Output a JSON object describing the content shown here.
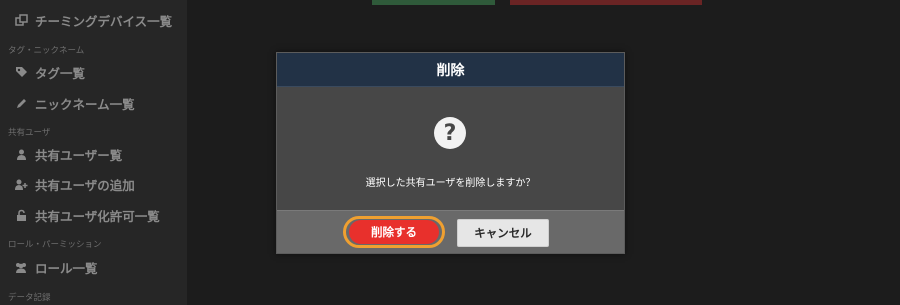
{
  "sidebar": {
    "items": [
      {
        "label": "チーミングデバイス一覧",
        "icon": "device-icon"
      },
      {
        "section": "タグ・ニックネーム"
      },
      {
        "label": "タグ一覧",
        "icon": "tag-icon"
      },
      {
        "label": "ニックネーム一覧",
        "icon": "pencil-icon"
      },
      {
        "section": "共有ユーザ"
      },
      {
        "label": "共有ユーザー覧",
        "icon": "user-icon"
      },
      {
        "label": "共有ユーザの追加",
        "icon": "user-plus-icon"
      },
      {
        "label": "共有ユーザ化許可一覧",
        "icon": "lock-icon"
      },
      {
        "section": "ロール・パーミッション"
      },
      {
        "label": "ロール一覧",
        "icon": "users-icon"
      },
      {
        "section": "データ記録"
      }
    ]
  },
  "modal": {
    "title": "削除",
    "icon": "question-icon",
    "message": "選択した共有ユーザを削除しますか？",
    "confirm_label": "削除する",
    "cancel_label": "キャンセル"
  },
  "colors": {
    "modal_header": "#223246",
    "confirm_button": "#e8302c",
    "highlight_ring": "#f0a030"
  }
}
